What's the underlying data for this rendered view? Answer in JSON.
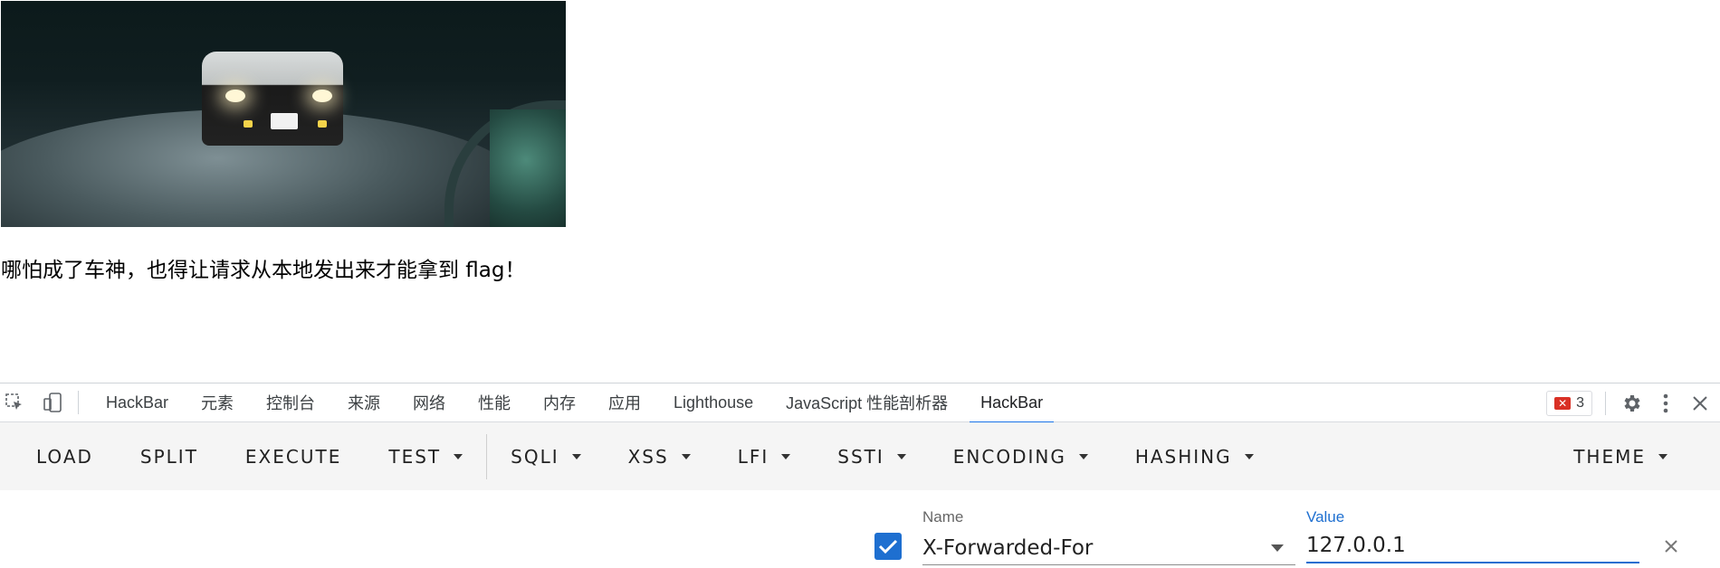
{
  "page": {
    "message": "哪怕成了车神，也得让请求从本地发出来才能拿到 flag！"
  },
  "devtools": {
    "tabs": [
      "HackBar",
      "元素",
      "控制台",
      "来源",
      "网络",
      "性能",
      "内存",
      "应用",
      "Lighthouse",
      "JavaScript 性能剖析器",
      "HackBar"
    ],
    "active_tab": "HackBar",
    "error_count": "3",
    "icons": [
      "inspect-icon",
      "device-toggle-icon",
      "error-icon",
      "gear-icon",
      "kebab-menu-icon",
      "close-icon"
    ]
  },
  "hackbar": {
    "buttons": {
      "load": "LOAD",
      "split": "SPLIT",
      "execute": "EXECUTE",
      "test": "TEST",
      "sqli": "SQLI",
      "xss": "XSS",
      "lfi": "LFI",
      "ssti": "SSTI",
      "encoding": "ENCODING",
      "hashing": "HASHING",
      "theme": "THEME"
    },
    "header_row": {
      "enabled": true,
      "name_label": "Name",
      "name_value": "X-Forwarded-For",
      "value_label": "Value",
      "value_value": "127.0.0.1"
    }
  },
  "colors": {
    "accent": "#1a73e8",
    "checkbox": "#1e6fd0",
    "error": "#d93025",
    "toolbar_bg": "#f5f5f5"
  }
}
